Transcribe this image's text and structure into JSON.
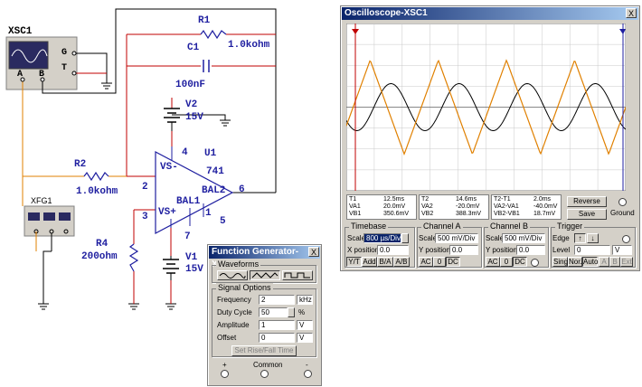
{
  "schematic": {
    "xsc1": "XSC1",
    "xsc_g": "G",
    "xsc_t": "T",
    "xsc_a": "A",
    "xsc_b": "B",
    "r1": "R1",
    "r1_val": "1.0kohm",
    "c1": "C1",
    "c1_val": "100nF",
    "v2": "V2",
    "v2_val": "15V",
    "u1": "U1",
    "u1_part": "741",
    "pin4": "4",
    "pin2": "2",
    "pin3": "3",
    "pin6": "6",
    "pin7": "7",
    "pin1": "1",
    "pin5": "5",
    "vs_minus": "VS-",
    "vs_plus": "VS+",
    "bal1": "BAL1",
    "bal2": "BAL2",
    "r2": "R2",
    "r2_val": "1.0kohm",
    "r4": "R4",
    "r4_val": "200ohm",
    "v1": "V1",
    "v1_val": "15V",
    "xfg1": "XFG1",
    "wire_colors": {
      "red": "#c00000",
      "orange": "#e08000",
      "black": "#000000",
      "blue": "#1f1fa0"
    }
  },
  "oscilloscope": {
    "title": "Oscilloscope-XSC1",
    "close": "X",
    "screen_bg": "#ffffff",
    "channel_a_color": "#e08000",
    "channel_b_color": "#000000",
    "readout": {
      "t1": {
        "label": "T1",
        "time": "12.5ms",
        "va": "20.0mV",
        "vb": "350.6mV",
        "la": "VA1",
        "lb": "VB1"
      },
      "t2": {
        "label": "T2",
        "time": "14.6ms",
        "va": "-20.0mV",
        "vb": "388.3mV",
        "la": "VA2",
        "lb": "VB2"
      },
      "diff": {
        "label": "T2-T1",
        "time": "2.0ms",
        "va": "-40.0mV",
        "vb": "18.7mV",
        "la": "VA2-VA1",
        "lb": "VB2-VB1"
      }
    },
    "reverse": "Reverse",
    "save": "Save",
    "ground": "Ground",
    "timebase": {
      "title": "Timebase",
      "scale_label": "Scale",
      "scale": "800 µs/Div",
      "xpos_label": "X position",
      "xpos": "0.0",
      "modes": [
        "Y/T",
        "Add",
        "B/A",
        "A/B"
      ]
    },
    "channel_a": {
      "title": "Channel A",
      "scale_label": "Scale",
      "scale": "500 mV/Div",
      "ypos_label": "Y position",
      "ypos": "0.0",
      "coupling": [
        "AC",
        "0",
        "DC"
      ]
    },
    "channel_b": {
      "title": "Channel B",
      "scale_label": "Scale",
      "scale": "500 mV/Div",
      "ypos_label": "Y position",
      "ypos": "0.0",
      "coupling": [
        "AC",
        "0",
        "DC"
      ]
    },
    "trigger": {
      "title": "Trigger",
      "edge_label": "Edge",
      "level_label": "Level",
      "level": "0",
      "level_unit": "V",
      "modes": [
        "Sing.",
        "Nor.",
        "Auto",
        "A",
        "B",
        "Ext"
      ]
    }
  },
  "function_generator": {
    "title": "Function Generator-XFG1",
    "close": "X",
    "waveforms_title": "Waveforms",
    "signal_options_title": "Signal Options",
    "frequency_label": "Frequency",
    "frequency": "2",
    "frequency_unit": "kHz",
    "duty_label": "Duty Cycle",
    "duty": "50",
    "duty_unit": "%",
    "amplitude_label": "Amplitude",
    "amplitude": "1",
    "amplitude_unit": "V",
    "offset_label": "Offset",
    "offset": "0",
    "offset_unit": "V",
    "rise_fall": "Set Rise/Fall Time",
    "plus": "+",
    "common": "Common",
    "minus": "-"
  }
}
